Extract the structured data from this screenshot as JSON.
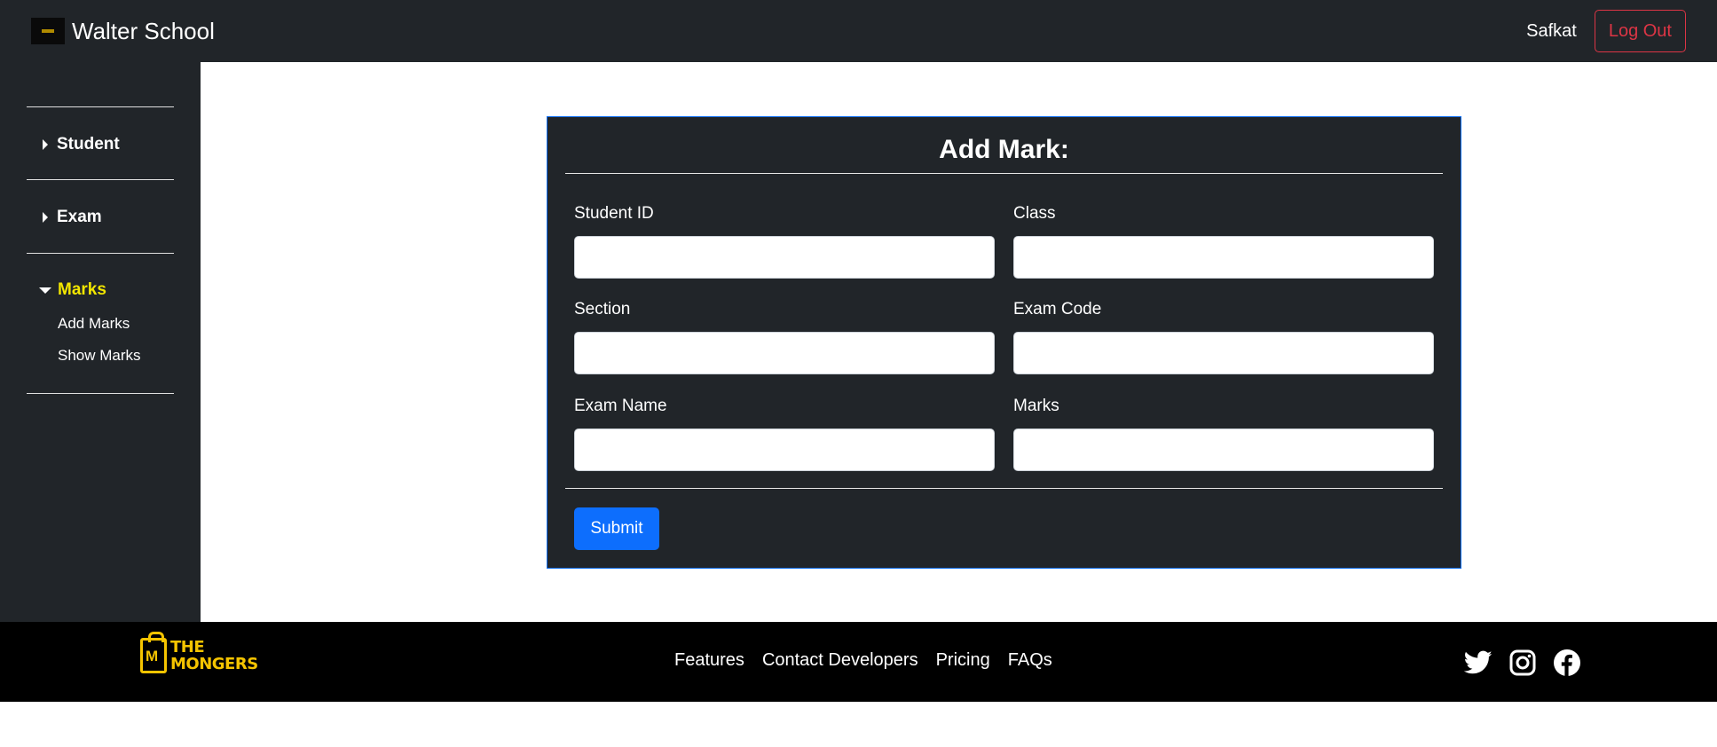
{
  "navbar": {
    "brand": "Walter School",
    "username": "Safkat",
    "logout_label": "Log Out"
  },
  "sidebar": {
    "items": [
      {
        "label": "Student",
        "expanded": false
      },
      {
        "label": "Exam",
        "expanded": false
      },
      {
        "label": "Marks",
        "expanded": true,
        "children": [
          "Add Marks",
          "Show Marks"
        ]
      }
    ],
    "active_color": "#f2e600"
  },
  "form": {
    "title": "Add Mark:",
    "fields": [
      {
        "label": "Student ID",
        "value": ""
      },
      {
        "label": "Class",
        "value": ""
      },
      {
        "label": "Section",
        "value": ""
      },
      {
        "label": "Exam Code",
        "value": ""
      },
      {
        "label": "Exam Name",
        "value": ""
      },
      {
        "label": "Marks",
        "value": ""
      }
    ],
    "submit_label": "Submit"
  },
  "footer": {
    "logo_line1": "THE",
    "logo_line2": "MONGERS",
    "links": [
      "Features",
      "Contact Developers",
      "Pricing",
      "FAQs"
    ],
    "social_icons": [
      "twitter-icon",
      "instagram-icon",
      "facebook-icon"
    ]
  },
  "colors": {
    "dark": "#212529",
    "primary": "#0d6efd",
    "danger": "#dc3545",
    "brand_yellow": "#f5c400"
  }
}
